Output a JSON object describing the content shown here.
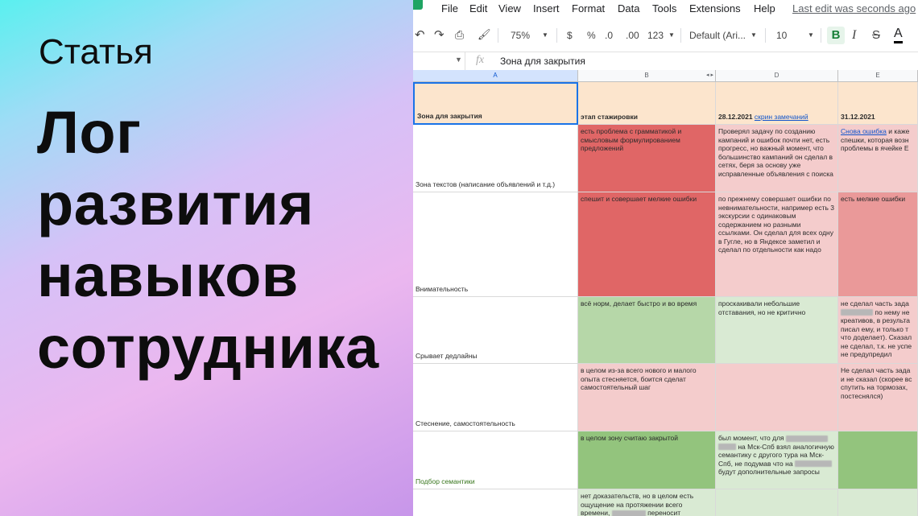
{
  "banner": {
    "badge": "Статья",
    "headline": [
      "Лог",
      "развития",
      "навыков",
      "сотрудника"
    ]
  },
  "menu": {
    "items": [
      "File",
      "Edit",
      "View",
      "Insert",
      "Format",
      "Data",
      "Tools",
      "Extensions",
      "Help"
    ],
    "last_edit": "Last edit was seconds ago"
  },
  "toolbar": {
    "zoom": "75%",
    "currency": "$",
    "percent": "%",
    "dec_less": ".0",
    "dec_more": ".00",
    "number_format": "123",
    "font": "Default (Ari...",
    "font_size": "10",
    "bold": "B",
    "italic": "I",
    "strike": "S",
    "text_color": "A"
  },
  "formula_bar": {
    "fx": "fx",
    "value": "Зона для закрытия"
  },
  "columns": [
    "A",
    "B",
    "D",
    "E"
  ],
  "header_row": {
    "a": "Зона для закрытия",
    "b": "этап стажировки",
    "d_date": "28.12.2021",
    "d_link": "скрин замечаний",
    "e_date": "31.12.2021"
  },
  "rows": [
    {
      "label": "Зона текстов (написание объявлений и т.д.)",
      "b": "есть проблема с грамматикой и смысловым формулированием предложений",
      "d": "Проверял задачу по созданию кампаний и ошибок почти нет, есть прогресс, но важный момент, что большинство кампаний он сделал в сетях, беря за основу уже исправленные объявления с поиска",
      "e_link": "Снова ошибка",
      "e": " и каже спешки, которая возн проблемы в ячейке Е"
    },
    {
      "label": "Внимательность",
      "b": "спешит и совершает мелкие ошибки",
      "d": "по прежнему совершает ошибки по невнимательности, например есть 3 экскурсии с одинаковым содержанием но разными ссылками. Он сделал для всех одну в Гугле, но в Яндексе заметил и сделал по отдельности как надо",
      "e": "есть мелкие ошибки"
    },
    {
      "label": "Срывает дедлайны",
      "b": "всё норм, делает быстро и во время",
      "d": "проскакивали небольшие отставания, но не критично",
      "e1": "не сделал часть зада",
      "e2": " по нему не",
      "e3": "креативов, в результа писал ему, и только т что доделает). Сказал не сделал, т.к. не успе не предупредил"
    },
    {
      "label": "Стеснение, самостоятельность",
      "b": "в целом из-за всего нового и малого опыта стесняется, боится сделат самостоятельный шаг",
      "d": "",
      "e": "Не сделал часть зада и не сказал (скорее вс спутить на тормозах, постеснялся)"
    },
    {
      "label": "Подбор семантики",
      "b": "в целом зону считаю закрытой",
      "d1": "был момент, что для ",
      "d2": " на Мск-Спб взял аналогичную семантику с другого тура на Мск-Спб, не подумав что на ",
      "d3": " будут дополнительные запросы",
      "e": ""
    },
    {
      "label": "",
      "b1": "нет доказательств, но в целом есть ощущение на протяжении всего времени, ",
      "b2": " переносит",
      "d": "",
      "e": ""
    }
  ]
}
